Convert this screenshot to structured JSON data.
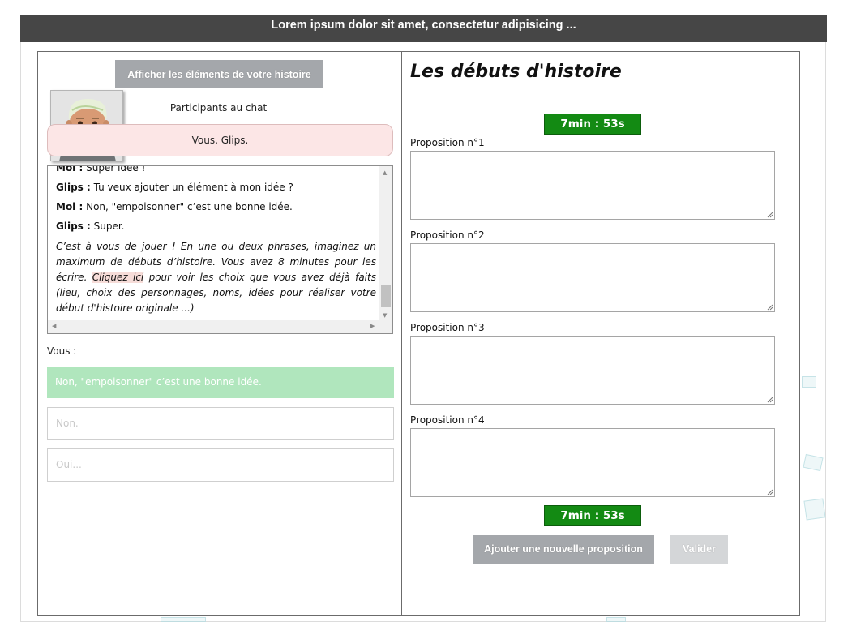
{
  "window": {
    "title": "Lorem ipsum dolor sit amet, consectetur adipisicing ..."
  },
  "left": {
    "show_elements_button": "Afficher les éléments de votre histoire",
    "avatar_icon": "user-avatar-icon",
    "participants_label": "Participants au chat",
    "participants_value": "Vous, Glips.",
    "chat": {
      "messages": [
        {
          "author": "Moi :",
          "text": " Super idée !"
        },
        {
          "author": "Glips :",
          "text": " Tu veux ajouter un élément à mon idée ?"
        },
        {
          "author": "Moi :",
          "text": " Non, \"empoisonner\" c’est une bonne idée."
        },
        {
          "author": "Glips :",
          "text": " Super."
        }
      ],
      "instruction_part1": "C’est à vous de jouer ! En une ou deux phrases, imaginez un maximum de débuts d’histoire. Vous avez 8 minutes pour les écrire.",
      "instruction_link": "Cliquez ici",
      "instruction_part2": "pour voir les choix que vous avez déjà faits (lieu, choix des personnages, noms, idées pour réaliser votre début d'histoire originale ...)"
    },
    "vous_label": "Vous :",
    "reply_options": [
      "Non, \"empoisonner\" c’est une bonne idée.",
      "Non.",
      "Oui..."
    ]
  },
  "right": {
    "title": "Les débuts d'histoire",
    "timer": "7min : 53s",
    "propositions": [
      {
        "label": "Proposition n°1",
        "value": ""
      },
      {
        "label": "Proposition n°2",
        "value": ""
      },
      {
        "label": "Proposition n°3",
        "value": ""
      },
      {
        "label": "Proposition n°4",
        "value": ""
      }
    ],
    "add_button": "Ajouter une nouvelle proposition",
    "validate_button": "Valider"
  },
  "colors": {
    "titlebar": "#464646",
    "timer": "#138a13",
    "reply_selected": "#b0e6bd",
    "participants_bg": "#fce6e6"
  }
}
